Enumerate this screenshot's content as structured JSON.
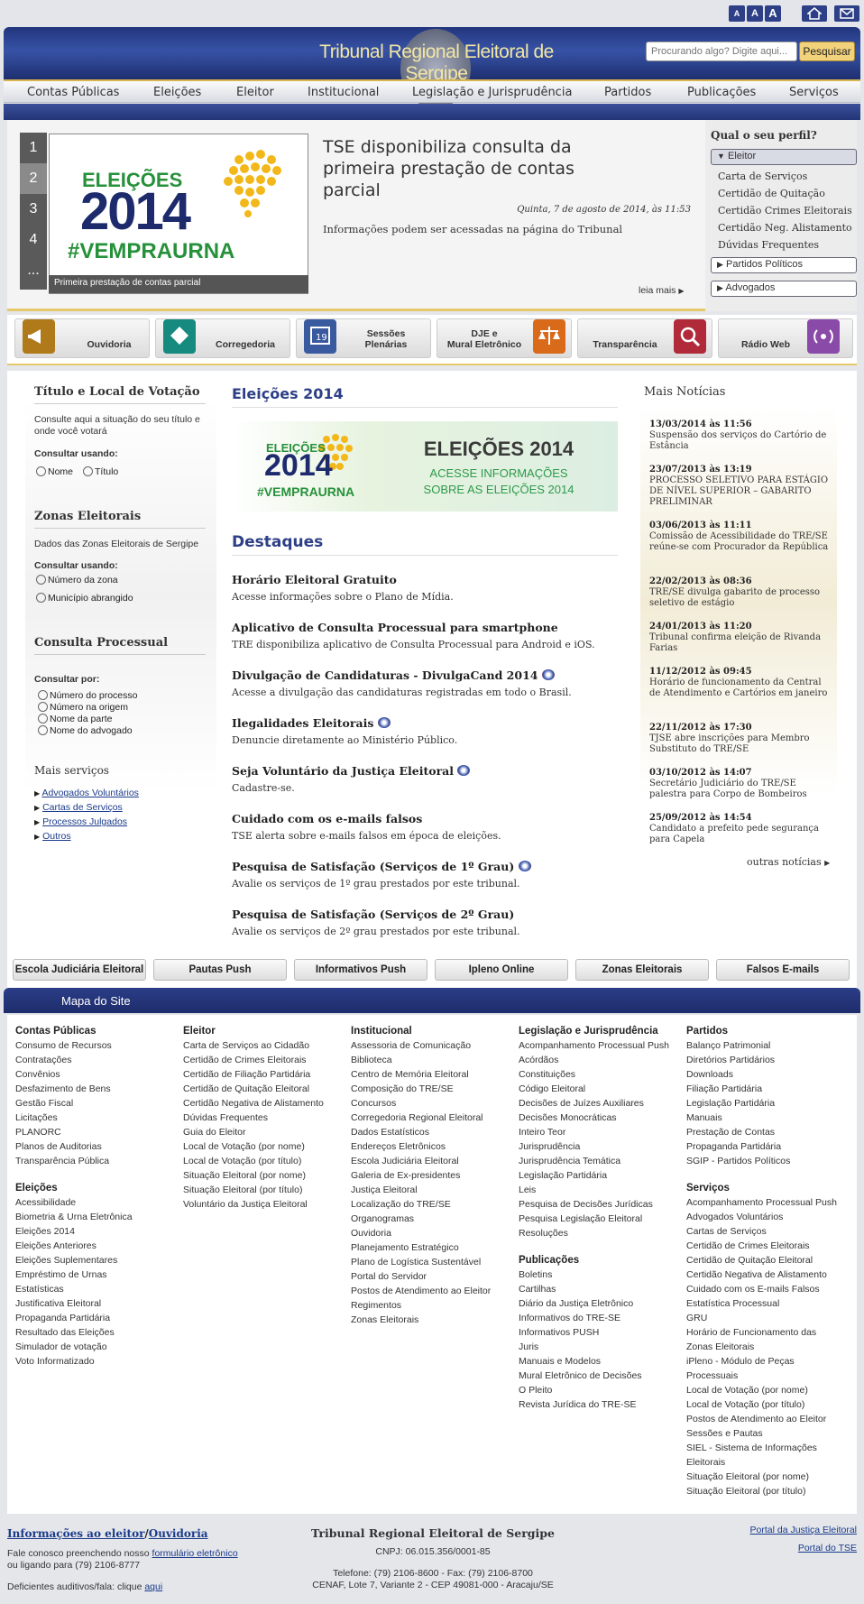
{
  "colors": {
    "primary": "#2d3f86",
    "accent": "#e5c96a",
    "button": "#f2d27a"
  },
  "topbar": {
    "font_small": "A",
    "font_medium": "A",
    "font_large": "A",
    "home_icon": "home-icon",
    "mail_icon": "mail-icon"
  },
  "header": {
    "title": "Tribunal Regional Eleitoral de Sergipe",
    "search_placeholder": "Procurando algo? Digite aqui...",
    "search_button": "Pesquisar"
  },
  "nav": [
    "Contas Públicas",
    "Eleições",
    "Eleitor",
    "Institucional",
    "Legislação e Jurisprudência",
    "Partidos",
    "Publicações",
    "Serviços"
  ],
  "slider": {
    "numbers": [
      "1",
      "2",
      "3",
      "4",
      "..."
    ],
    "active": "2",
    "image_top": "ELEIÇÕES",
    "image_year": "2014",
    "image_tag": "#VEMPRAURNA",
    "caption": "Primeira prestação de contas parcial"
  },
  "news": {
    "title": "TSE disponibiliza consulta da primeira prestação de contas parcial",
    "date": "Quinta, 7 de agosto de 2014, às 11:53",
    "summary": "Informações podem ser acessadas na página do Tribunal",
    "more": "leia mais"
  },
  "profile": {
    "title": "Qual o seu perfil?",
    "active": "Eleitor",
    "links": [
      "Carta de Serviços",
      "Certidão de Quitação",
      "Certidão Crimes Eleitorais",
      "Certidão Neg. Alistamento",
      "Dúvidas Frequentes"
    ],
    "other1": "Partidos Políticos",
    "other2": "Advogados"
  },
  "services": [
    {
      "label": "Ouvidoria"
    },
    {
      "label": "Corregedoria"
    },
    {
      "label1": "Sessões",
      "label2": "Plenárias"
    },
    {
      "label1": "DJE e",
      "label2": "Mural Eletrônico"
    },
    {
      "label": "Transparência"
    },
    {
      "label": "Rádio Web"
    }
  ],
  "left": {
    "titulo": {
      "title": "Título e Local de Votação",
      "text": "Consulte aqui a situação do seu título e onde você votará",
      "consultar": "Consultar usando:",
      "opt1": "Nome",
      "opt2": "Título"
    },
    "zonas": {
      "title": "Zonas Eleitorais",
      "text": "Dados das Zonas Eleitorais de Sergipe",
      "consultar": "Consultar usando:",
      "opt1": "Número da zona",
      "opt2": "Município abrangido"
    },
    "processual": {
      "title": "Consulta Processual",
      "consultar": "Consultar por:",
      "opts": [
        "Número do processo",
        "Número na origem",
        "Nome da parte",
        "Nome do advogado"
      ]
    },
    "mais": {
      "title": "Mais serviços",
      "links": [
        "Advogados Voluntários",
        "Cartas de Serviços",
        "Processos Julgados",
        "Outros"
      ]
    }
  },
  "center": {
    "title": "Eleições 2014",
    "banner": {
      "logo_top": "ELEIÇÕES",
      "logo_year": "2014",
      "logo_tag": "#VEMPRAURNA",
      "headline": "ELEIÇÕES 2014",
      "line1": "ACESSE INFORMAÇÕES",
      "line2": "SOBRE AS ELEIÇÕES 2014"
    },
    "destaques_title": "Destaques",
    "items": [
      {
        "title": "Horário Eleitoral Gratuito",
        "desc": "Acesse informações  sobre o Plano de Mídia."
      },
      {
        "title": "Aplicativo de Consulta Processual para smartphone",
        "desc": "TRE disponibiliza aplicativo de Consulta Processual para Android e iOS."
      },
      {
        "title": "Divulgação de Candidaturas - DivulgaCand 2014",
        "desc": "Acesse  a divulgação das candidaturas registradas em todo o Brasil."
      },
      {
        "title": "Ilegalidades Eleitorais",
        "desc": "Denuncie diretamente ao Ministério Público."
      },
      {
        "title": "Seja Voluntário da Justiça Eleitoral",
        "desc": "Cadastre-se."
      },
      {
        "title": "Cuidado com os e-mails falsos",
        "desc": "TSE alerta sobre e-mails falsos em época de eleições."
      },
      {
        "title": "Pesquisa de Satisfação (Serviços de 1º Grau)",
        "desc": "Avalie os serviços de 1º grau prestados por este tribunal."
      },
      {
        "title": "Pesquisa de Satisfação (Serviços de 2º Grau)",
        "desc": "Avalie os serviços de 2º grau prestados por este tribunal."
      }
    ]
  },
  "mais_noticias": {
    "title": "Mais Notícias",
    "items": [
      {
        "date": "13/03/2014 às 11:56",
        "text": "Suspensão dos serviços do Cartório de Estância"
      },
      {
        "date": "23/07/2013 às 13:19",
        "text": "PROCESSO SELETIVO PARA ESTÁGIO DE NÍVEL SUPERIOR – GABARITO PRELIMINAR"
      },
      {
        "date": "03/06/2013 às 11:11",
        "text": "Comissão de Acessibilidade do TRE/SE reúne-se com Procurador da República"
      },
      {
        "date": "22/02/2013 às 08:36",
        "text": "TRE/SE divulga gabarito de processo seletivo de estágio"
      },
      {
        "date": "24/01/2013 às 11:20",
        "text": "Tribunal confirma eleição de Rivanda Farias"
      },
      {
        "date": "11/12/2012 às 09:45",
        "text": "Horário de funcionamento da Central de Atendimento e Cartórios em janeiro"
      },
      {
        "date": "22/11/2012 às 17:30",
        "text": "TJSE abre inscrições para Membro Substituto do TRE/SE"
      },
      {
        "date": "03/10/2012 às 14:07",
        "text": "Secretário Judiciário do TRE/SE palestra para Corpo de Bombeiros"
      },
      {
        "date": "25/09/2012 às 14:54",
        "text": "Candidato a prefeito pede segurança para Capela"
      }
    ],
    "outras": "outras notícias"
  },
  "quick": [
    "Escola Judiciária Eleitoral",
    "Pautas Push",
    "Informativos Push",
    "Ipleno Online",
    "Zonas Eleitorais",
    "Falsos E-mails"
  ],
  "mapa": {
    "title": "Mapa do Site",
    "col1": {
      "h1": "Contas Públicas",
      "l1": [
        "Consumo de Recursos",
        "Contratações",
        "Convênios",
        "Desfazimento de Bens",
        "Gestão Fiscal",
        "Licitações",
        "PLANORC",
        "Planos de Auditorias",
        "Transparência Pública"
      ],
      "h2": "Eleições",
      "l2": [
        "Acessibilidade",
        "Biometria & Urna Eletrônica",
        "Eleições 2014",
        "Eleições Anteriores",
        "Eleições Suplementares",
        "Empréstimo de Urnas",
        "Estatísticas",
        "Justificativa Eleitoral",
        "Propaganda Partidária",
        "Resultado das Eleições",
        "Simulador de votação",
        "Voto Informatizado"
      ]
    },
    "col2": {
      "h1": "Eleitor",
      "l1": [
        "Carta de Serviços ao Cidadão",
        "Certidão de Crimes Eleitorais",
        "Certidão de Filiação Partidária",
        "Certidão de Quitação Eleitoral",
        "Certidão Negativa de Alistamento",
        "Dúvidas Frequentes",
        "Guia do Eleitor",
        "Local de Votação (por nome)",
        "Local de Votação (por título)",
        "Situação Eleitoral (por nome)",
        "Situação Eleitoral (por título)",
        "Voluntário da Justiça Eleitoral"
      ]
    },
    "col3": {
      "h1": "Institucional",
      "l1": [
        "Assessoria de Comunicação",
        "Biblioteca",
        "Centro de Memória Eleitoral",
        "Composição do TRE/SE",
        "Concursos",
        "Corregedoria Regional Eleitoral",
        "Dados Estatísticos",
        "Endereços Eletrônicos",
        "Escola Judiciária Eleitoral",
        "Galeria de Ex-presidentes",
        "Justiça Eleitoral",
        "Localização do TRE/SE",
        "Organogramas",
        "Ouvidoria",
        "Planejamento Estratégico",
        "Plano de Logística Sustentável",
        "Portal do Servidor",
        "Postos de Atendimento ao Eleitor",
        "Regimentos",
        "Zonas Eleitorais"
      ]
    },
    "col4": {
      "h1": "Legislação e Jurisprudência",
      "l1": [
        "Acompanhamento Processual Push",
        "Acórdãos",
        "Constituições",
        "Código Eleitoral",
        "Decisões de Juízes Auxiliares",
        "Decisões Monocráticas",
        "Inteiro Teor",
        "Jurisprudência",
        "Jurisprudência Temática",
        "Legislação Partidária",
        "Leis",
        "Pesquisa de Decisões Jurídicas",
        "Pesquisa Legislação Eleitoral",
        "Resoluções"
      ],
      "h2": "Publicações",
      "l2": [
        "Boletins",
        "Cartilhas",
        "Diário da Justiça Eletrônico",
        "Informativos do TRE-SE",
        "Informativos PUSH",
        "Juris",
        "Manuais e Modelos",
        "Mural Eletrônico de Decisões",
        "O Pleito",
        "Revista Jurídica do TRE-SE"
      ]
    },
    "col5": {
      "h1": "Partidos",
      "l1": [
        "Balanço Patrimonial",
        "Diretórios Partidários",
        "Downloads",
        "Filiação Partidária",
        "Legislação Partidária",
        "Manuais",
        "Prestação de Contas",
        "Propaganda Partidária",
        "SGIP - Partidos Políticos"
      ],
      "h2": "Serviços",
      "l2": [
        "Acompanhamento Processual Push",
        "Advogados Voluntários",
        "Cartas de Serviços",
        "Certidão de Crimes Eleitorais",
        "Certidão de Quitação Eleitoral",
        "Certidão Negativa de Alistamento",
        "Cuidado com os E-mails Falsos",
        "Estatística Processual",
        "GRU",
        "Horário de Funcionamento das",
        "Zonas Eleitorais",
        "iPleno - Módulo de Peças",
        "Processuais",
        "Local de Votação (por nome)",
        "Local de Votação (por título)",
        "Postos de Atendimento ao Eleitor",
        "Sessões e Pautas",
        "SIEL - Sistema de Informações",
        "Eleitorais",
        "Situação Eleitoral (por nome)",
        "Situação Eleitoral (por título)"
      ]
    }
  },
  "footer": {
    "info_link": "Informações ao eleitor",
    "sep": "/",
    "ouvidoria_link": "Ouvidoria",
    "contact_pre": "Fale conosco preenchendo nosso ",
    "contact_link": "formulário eletrônico",
    "contact_post": "ou ligando para (79) 2106-8777",
    "deficientes": "Deficientes auditivos/fala: clique ",
    "aqui": "aqui",
    "org": "Tribunal Regional Eleitoral de Sergipe",
    "cnpj": "CNPJ: 06.015.356/0001-85",
    "phones": "Telefone: (79) 2106-8600 - Fax: (79) 2106-8700",
    "address": "CENAF, Lote 7, Variante 2 - CEP 49081-000 - Aracaju/SE",
    "portal1": "Portal da Justiça Eleitoral",
    "portal2": "Portal do TSE"
  }
}
